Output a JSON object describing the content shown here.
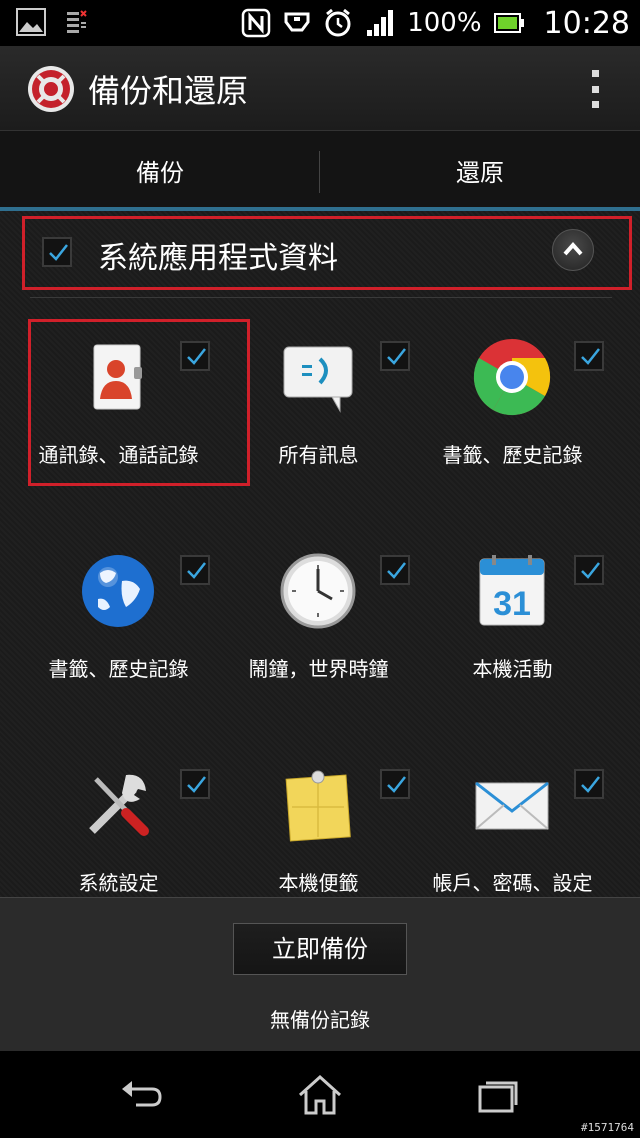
{
  "status_bar": {
    "icons": [
      "gallery-icon",
      "calendar-notification-icon",
      "nfc-icon",
      "usb-icon",
      "alarm-icon",
      "signal-icon"
    ],
    "battery_percent": "100%",
    "battery_level": 1.0,
    "time": "10:28"
  },
  "action_bar": {
    "title": "備份和還原",
    "icon": "backup-restore-app-icon",
    "menu_icon": "overflow-menu-icon"
  },
  "tabs": [
    {
      "label": "備份",
      "selected": true
    },
    {
      "label": "還原",
      "selected": false
    }
  ],
  "section": {
    "title": "系統應用程式資料",
    "checked": true,
    "collapse_icon": "chevron-up-icon"
  },
  "items": [
    {
      "label": "通訊錄、通話記錄",
      "icon": "contacts-icon",
      "checked": true
    },
    {
      "label": "所有訊息",
      "icon": "messaging-icon",
      "checked": true
    },
    {
      "label": "書籤、歷史記錄",
      "icon": "chrome-icon",
      "checked": true
    },
    {
      "label": "書籤、歷史記錄",
      "icon": "browser-globe-icon",
      "checked": true
    },
    {
      "label": "鬧鐘，世界時鐘",
      "icon": "clock-icon",
      "checked": true
    },
    {
      "label": "本機活動",
      "icon": "calendar-icon",
      "calendar_day": "31",
      "checked": true
    },
    {
      "label": "系統設定",
      "icon": "settings-tools-icon",
      "checked": true
    },
    {
      "label": "本機便籤",
      "icon": "notes-icon",
      "checked": true
    },
    {
      "label": "帳戶、密碼、設定",
      "icon": "email-icon",
      "checked": true
    }
  ],
  "bottom": {
    "backup_button": "立即備份",
    "status": "無備份記錄"
  },
  "nav_bar": {
    "back_icon": "back-icon",
    "home_icon": "home-icon",
    "recents_icon": "recent-apps-icon"
  },
  "watermark": "#1571764",
  "colors": {
    "accent": "#2f6f8f",
    "highlight_border": "#d0202a",
    "check": "#3aa6e0"
  }
}
